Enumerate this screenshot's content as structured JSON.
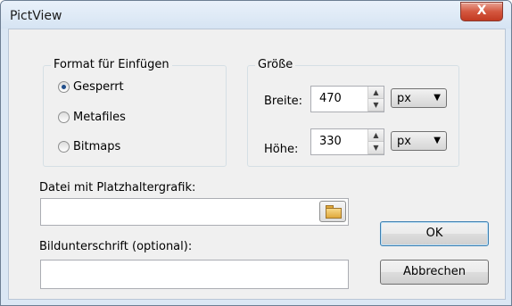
{
  "window": {
    "title": "PictView",
    "close_glyph": "X"
  },
  "format_group": {
    "legend": "Format für Einfügen",
    "options": [
      {
        "label": "Gesperrt",
        "checked": true
      },
      {
        "label": "Metafiles",
        "checked": false
      },
      {
        "label": "Bitmaps",
        "checked": false
      }
    ]
  },
  "size_group": {
    "legend": "Größe",
    "width_label": "Breite:",
    "width_value": "470",
    "width_unit": "px",
    "height_label": "Höhe:",
    "height_value": "330",
    "height_unit": "px"
  },
  "placeholder": {
    "label": "Datei mit Platzhaltergrafik:",
    "value": "",
    "browse_icon": "folder-icon"
  },
  "caption": {
    "label": "Bildunterschrift (optional):",
    "value": ""
  },
  "buttons": {
    "ok": "OK",
    "cancel": "Abbrechen"
  },
  "colors": {
    "title_bar": "#dbe7f4",
    "close_button": "#c9452d",
    "client": "#f0f0f0"
  }
}
